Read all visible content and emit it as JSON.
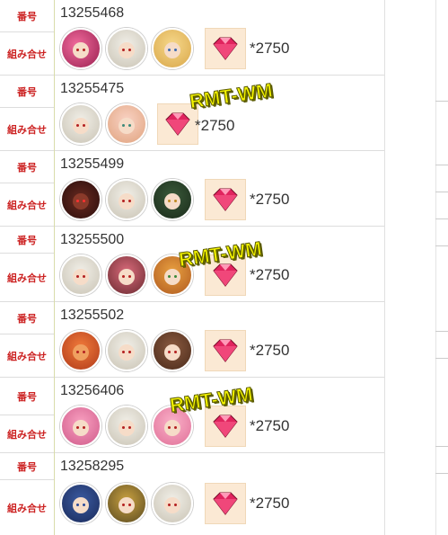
{
  "labels": {
    "number": "番号",
    "combo": "組み合せ"
  },
  "rows": [
    {
      "id": "13255468",
      "gems": "*2750",
      "icons": [
        "demon-pink-icon",
        "white-haired-girl-icon",
        "blonde-boy-icon"
      ]
    },
    {
      "id": "13255475",
      "gems": "*2750",
      "icons": [
        "white-haired-girl-icon",
        "pink-flower-girl-icon"
      ]
    },
    {
      "id": "13255499",
      "gems": "*2750",
      "icons": [
        "dragon-icon",
        "white-haired-girl-icon",
        "green-haired-girl-icon"
      ]
    },
    {
      "id": "13255500",
      "gems": "*2750",
      "icons": [
        "white-haired-girl-icon",
        "pink-haired-girl-icon",
        "autumn-girl-icon"
      ]
    },
    {
      "id": "13255502",
      "gems": "*2750",
      "icons": [
        "orange-mask-icon",
        "white-haired-girl-icon",
        "brown-haired-girl-icon"
      ]
    },
    {
      "id": "13256406",
      "gems": "*2750",
      "icons": [
        "pink-twin-tail-girl-icon",
        "white-haired-girl-icon",
        "pink-bunny-girl-icon"
      ]
    },
    {
      "id": "13258295",
      "gems": "*2750",
      "icons": [
        "blue-haired-boy-icon",
        "gold-armored-girl-icon",
        "white-haired-girl-icon"
      ]
    }
  ],
  "watermark": "RMT-WM",
  "colors": {
    "label_red": "#cc2222",
    "gem_bg": "#fbe9d4",
    "watermark_yellow": "#f4f400"
  }
}
